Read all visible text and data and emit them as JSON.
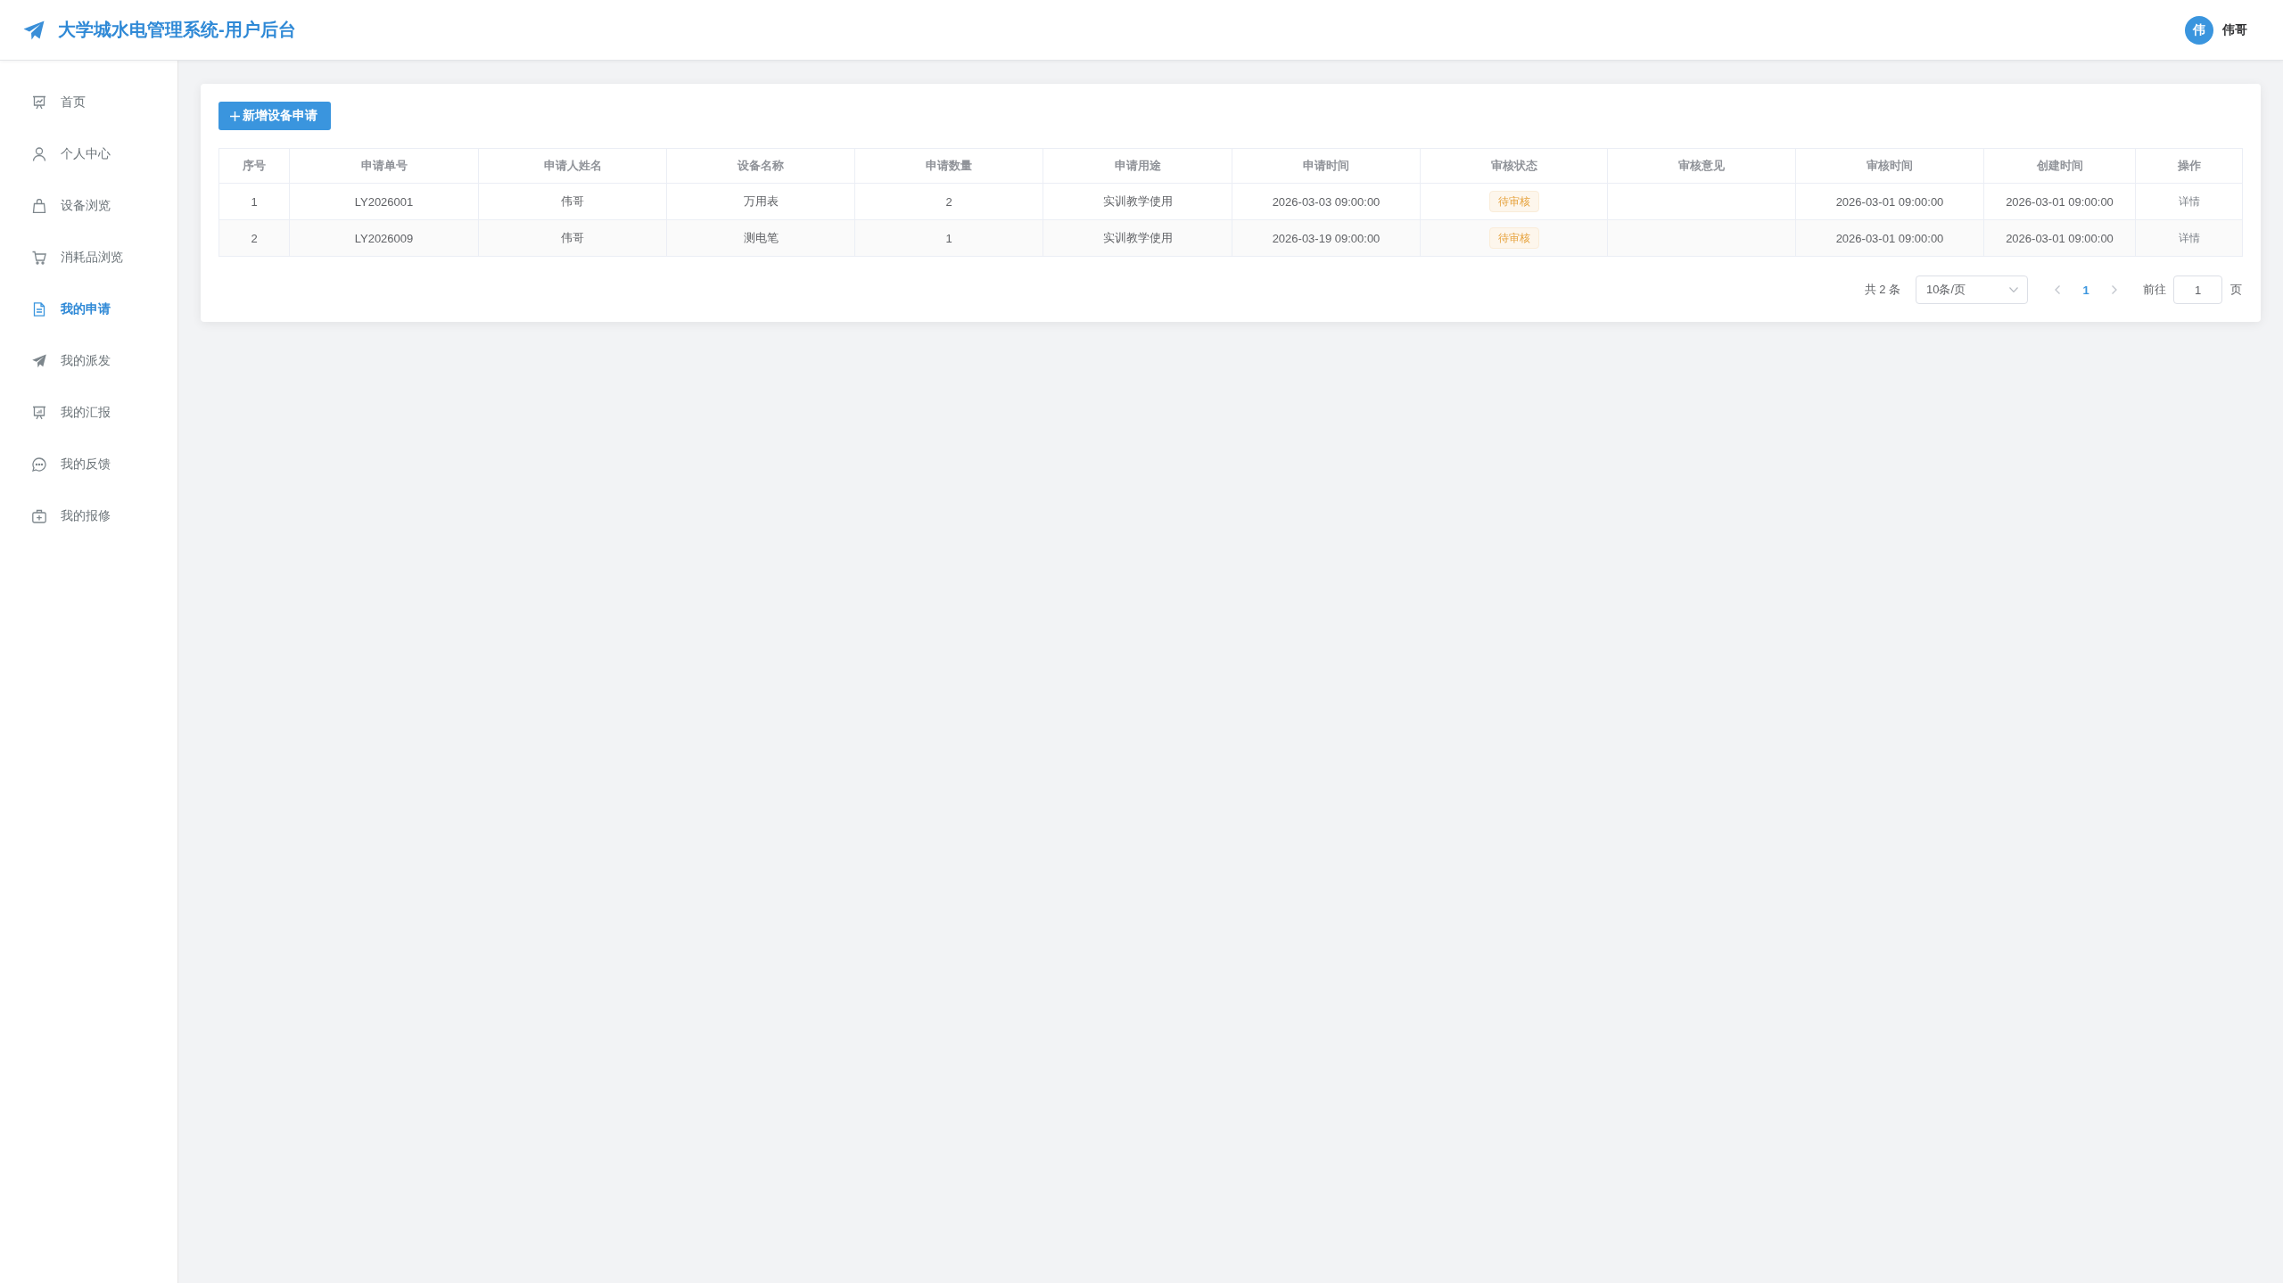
{
  "header": {
    "title": "大学城水电管理系统-用户后台",
    "user": {
      "avatar_text": "伟",
      "name": "伟哥"
    }
  },
  "sidebar": {
    "items": [
      {
        "label": "首页",
        "selected": false
      },
      {
        "label": "个人中心",
        "selected": false
      },
      {
        "label": "设备浏览",
        "selected": false
      },
      {
        "label": "消耗品浏览",
        "selected": false
      },
      {
        "label": "我的申请",
        "selected": true
      },
      {
        "label": "我的派发",
        "selected": false
      },
      {
        "label": "我的汇报",
        "selected": false
      },
      {
        "label": "我的反馈",
        "selected": false
      },
      {
        "label": "我的报修",
        "selected": false
      }
    ]
  },
  "toolbar": {
    "buttons": [
      {
        "label": "新增设备申请"
      }
    ]
  },
  "table": {
    "columns": [
      "序号",
      "申请单号",
      "申请人姓名",
      "设备名称",
      "申请数量",
      "申请用途",
      "申请时间",
      "审核状态",
      "审核意见",
      "审核时间",
      "创建时间",
      "操作"
    ],
    "rows": [
      {
        "cells": [
          {
            "kind": "text",
            "text": "1"
          },
          {
            "kind": "text",
            "text": "LY2026001"
          },
          {
            "kind": "text",
            "text": "伟哥"
          },
          {
            "kind": "text",
            "text": "万用表"
          },
          {
            "kind": "text",
            "text": "2"
          },
          {
            "kind": "text",
            "text": "实训教学使用"
          },
          {
            "kind": "text",
            "text": "2026-03-03 09:00:00"
          },
          {
            "kind": "tag",
            "text": "待审核"
          },
          {
            "kind": "empty"
          },
          {
            "kind": "text",
            "text": "2026-03-01 09:00:00"
          },
          {
            "kind": "text",
            "text": "2026-03-01 09:00:00"
          },
          {
            "kind": "link",
            "text": "详情"
          }
        ]
      },
      {
        "cells": [
          {
            "kind": "text",
            "text": "2"
          },
          {
            "kind": "text",
            "text": "LY2026009"
          },
          {
            "kind": "text",
            "text": "伟哥"
          },
          {
            "kind": "text",
            "text": "测电笔"
          },
          {
            "kind": "text",
            "text": "1"
          },
          {
            "kind": "text",
            "text": "实训教学使用"
          },
          {
            "kind": "text",
            "text": "2026-03-19 09:00:00"
          },
          {
            "kind": "tag",
            "text": "待审核"
          },
          {
            "kind": "empty"
          },
          {
            "kind": "text",
            "text": "2026-03-01 09:00:00"
          },
          {
            "kind": "text",
            "text": "2026-03-01 09:00:00"
          },
          {
            "kind": "link",
            "text": "详情"
          }
        ]
      }
    ]
  },
  "pagination": {
    "total": "共 2 条",
    "page_size": "10条/页",
    "prev": {
      "disabled": true
    },
    "pages": [
      {
        "label": "1",
        "selected": true
      }
    ],
    "next": {
      "disabled": true
    },
    "goto_label": "前往",
    "goto_value": "1",
    "goto_suffix": "页"
  }
}
